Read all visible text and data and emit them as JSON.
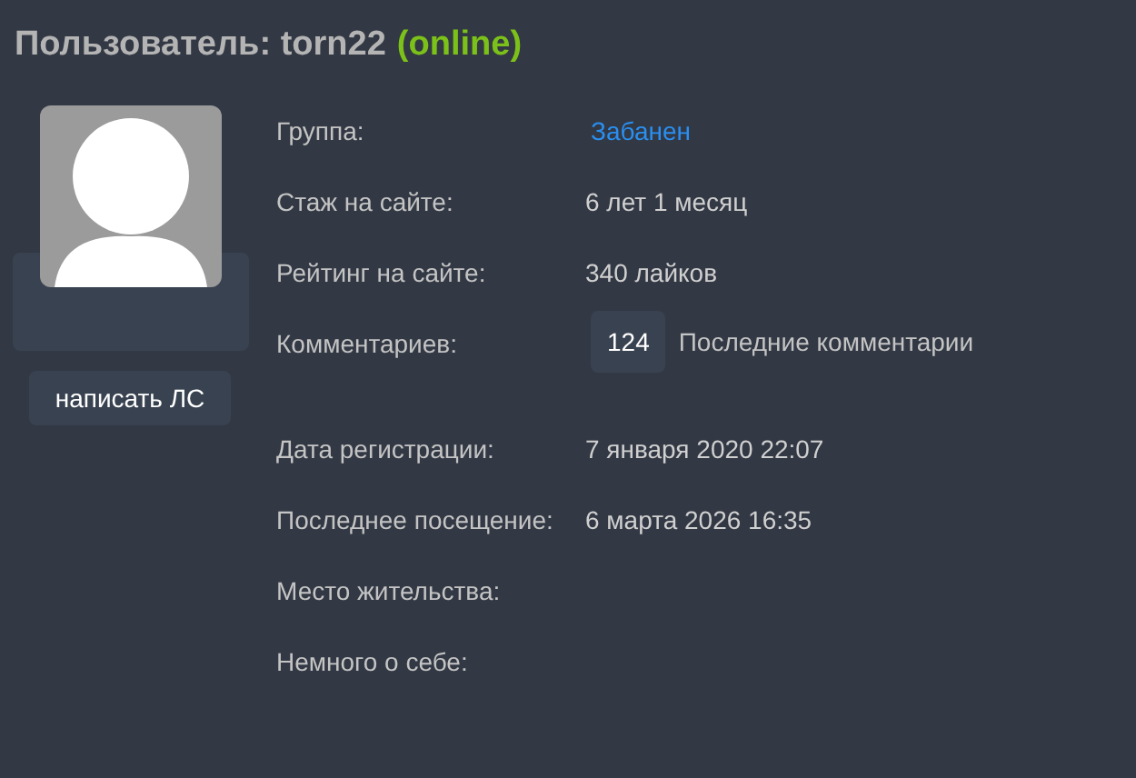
{
  "title": {
    "prefix": "Пользователь: torn22",
    "status": "(online)"
  },
  "send_message_button": "написать ЛС",
  "fields": [
    {
      "kind": "link",
      "label": "Группа:",
      "value": "Забанен"
    },
    {
      "kind": "text",
      "label": "Стаж на сайте:",
      "value": "6 лет 1 месяц"
    },
    {
      "kind": "text",
      "label": "Рейтинг на сайте:",
      "value": "340 лайков"
    },
    {
      "kind": "comments",
      "label": "Комментариев:",
      "count": "124",
      "link": "Последние комментарии"
    },
    {
      "kind": "text",
      "label": "Дата регистрации:",
      "value": "7 января 2020 22:07"
    },
    {
      "kind": "text",
      "label": "Последнее посещение:",
      "value": "6 марта 2026 16:35"
    },
    {
      "kind": "empty",
      "label": "Место жительства:"
    },
    {
      "kind": "empty",
      "label": "Немного о себе:"
    }
  ]
}
